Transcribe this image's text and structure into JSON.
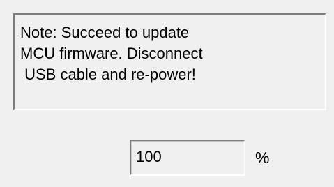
{
  "note": {
    "lines": [
      "Note: Succeed to update",
      "MCU firmware. Disconnect",
      " USB cable and re-power!"
    ]
  },
  "progress": {
    "value": "100",
    "unit": "%"
  }
}
